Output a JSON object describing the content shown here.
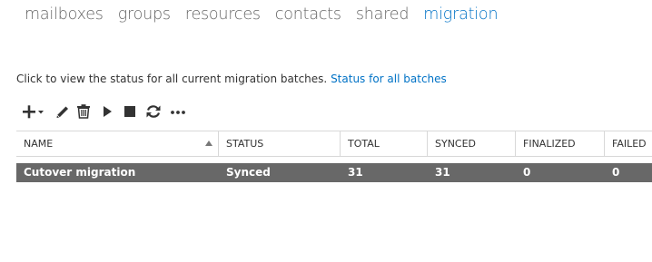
{
  "tabs": [
    {
      "label": "mailboxes"
    },
    {
      "label": "groups"
    },
    {
      "label": "resources"
    },
    {
      "label": "contacts"
    },
    {
      "label": "shared"
    },
    {
      "label": "migration",
      "active": true
    }
  ],
  "status_line": {
    "text": "Click to view the status for all current migration batches.",
    "link": "Status for all batches"
  },
  "toolbar": {
    "buttons": [
      {
        "icon": "add-icon",
        "has_dropdown": true
      },
      {
        "icon": "edit-icon"
      },
      {
        "icon": "delete-icon"
      },
      {
        "icon": "start-icon"
      },
      {
        "icon": "stop-icon"
      },
      {
        "icon": "refresh-icon"
      },
      {
        "icon": "more-icon"
      }
    ],
    "accent_color": "#333333"
  },
  "table": {
    "columns": [
      "NAME",
      "STATUS",
      "TOTAL",
      "SYNCED",
      "FINALIZED",
      "FAILED"
    ],
    "sorted_column": "NAME",
    "sort_direction": "ascending",
    "rows": [
      {
        "name": "Cutover migration",
        "status": "Synced",
        "total": "31",
        "synced": "31",
        "finalized": "0",
        "failed": "0",
        "selected": true
      }
    ]
  },
  "colors": {
    "accent": "#0072c6",
    "selected_row": "#686868",
    "tab_inactive": "#666666"
  }
}
